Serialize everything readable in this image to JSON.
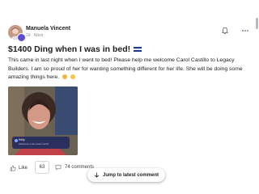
{
  "post": {
    "author": "Manuela Vincent",
    "meta": "2d · Wesl",
    "title": "$1400 Ding when I was in bed!",
    "body": "This came in last night when I went to bed! Please help me welcome Carol Castillo to Legacy Builders. I am so proud of her for wanting something different for her life. She will be doing some amazing things here.",
    "media_card": {
      "name": "Kelly",
      "subtitle": "Welcome to the team Carol!"
    }
  },
  "actions": {
    "like_label": "Like",
    "like_count": "63",
    "comments_label": "74 comments"
  },
  "jump_button": {
    "label": "Jump to latest comment"
  },
  "icons": {
    "flag": "flag-icon",
    "bell": "bell-icon",
    "more": "more-icon",
    "like": "thumbs-up-icon",
    "comment": "comment-icon",
    "arrow": "arrow-down-icon"
  }
}
